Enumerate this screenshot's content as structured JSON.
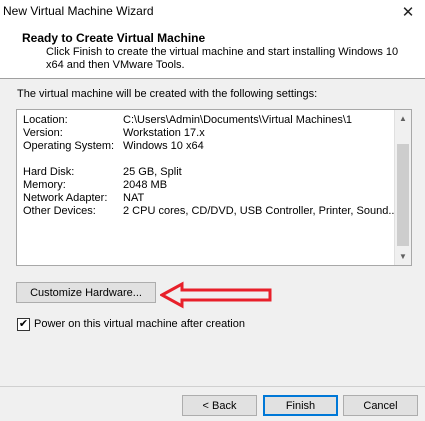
{
  "window": {
    "title": "New Virtual Machine Wizard"
  },
  "header": {
    "title": "Ready to Create Virtual Machine",
    "description": "Click Finish to create the virtual machine and start installing Windows 10 x64 and then VMware Tools."
  },
  "intro": "The virtual machine will be created with the following settings:",
  "settings": [
    {
      "label": "Location:",
      "value": "C:\\Users\\Admin\\Documents\\Virtual Machines\\1"
    },
    {
      "label": "Version:",
      "value": "Workstation 17.x"
    },
    {
      "label": "Operating System:",
      "value": "Windows 10 x64"
    },
    {
      "label": "",
      "value": ""
    },
    {
      "label": "Hard Disk:",
      "value": "25 GB, Split"
    },
    {
      "label": "Memory:",
      "value": "2048 MB"
    },
    {
      "label": "Network Adapter:",
      "value": "NAT"
    },
    {
      "label": "Other Devices:",
      "value": "2 CPU cores, CD/DVD, USB Controller, Printer, Sound..."
    }
  ],
  "customize_label": "Customize Hardware...",
  "power_on": {
    "label": "Power on this virtual machine after creation",
    "checked": true
  },
  "buttons": {
    "back": "< Back",
    "finish": "Finish",
    "cancel": "Cancel"
  },
  "icons": {
    "close": "close-icon",
    "scroll_up": "chevron-up-icon",
    "scroll_down": "chevron-down-icon",
    "check": "checkmark-icon",
    "annotation": "red-arrow-icon"
  },
  "colors": {
    "annotation_arrow": "#e8202a",
    "default_button_border": "#0078d7"
  }
}
